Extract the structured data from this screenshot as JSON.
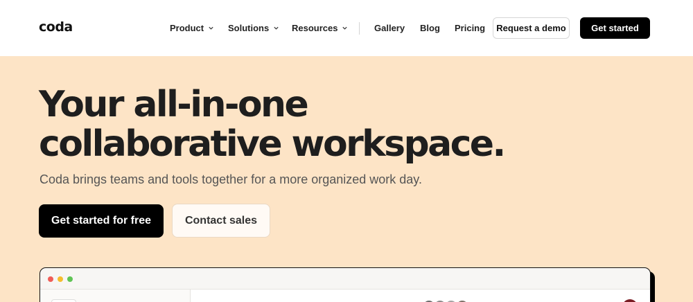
{
  "nav": {
    "logo": "coda",
    "items": [
      {
        "label": "Product",
        "has_dropdown": true
      },
      {
        "label": "Solutions",
        "has_dropdown": true
      },
      {
        "label": "Resources",
        "has_dropdown": true
      },
      {
        "label": "Gallery",
        "has_dropdown": false
      },
      {
        "label": "Blog",
        "has_dropdown": false
      },
      {
        "label": "Pricing",
        "has_dropdown": false
      }
    ],
    "request_demo_label": "Request a demo",
    "get_started_label": "Get started"
  },
  "hero": {
    "headline_line1": "Your all-in-one",
    "headline_line2": "collaborative workspace.",
    "subtitle": "Coda brings teams and tools together for a more organized work day.",
    "primary_cta": "Get started for free",
    "secondary_cta": "Contact sales"
  },
  "colors": {
    "hero_background": "#fde4c6",
    "primary_button": "#000000",
    "window_dot_red": "#ef5d57",
    "window_dot_yellow": "#f5bd2e",
    "window_dot_green": "#5fc455"
  },
  "icons": {
    "dropdown": "chevron-down-icon"
  }
}
